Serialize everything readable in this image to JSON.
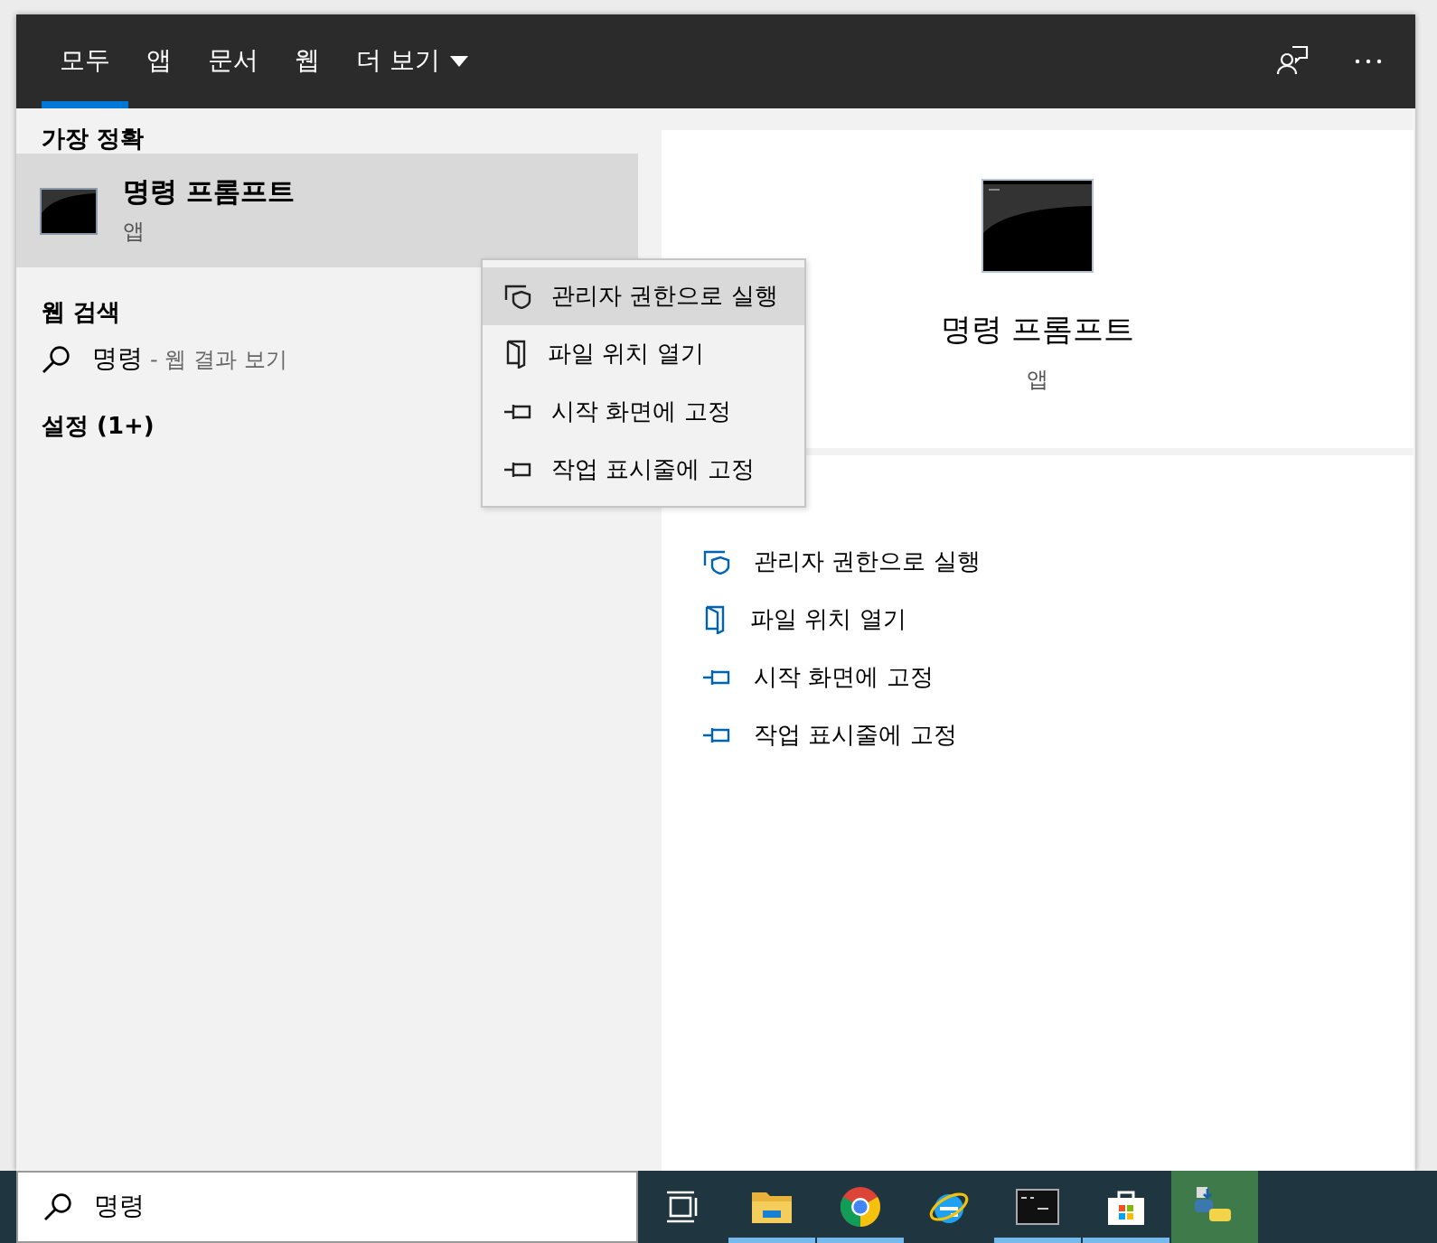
{
  "tabs": [
    {
      "label": "모두",
      "selected": true,
      "dropdown": false
    },
    {
      "label": "앱",
      "selected": false,
      "dropdown": false
    },
    {
      "label": "문서",
      "selected": false,
      "dropdown": false
    },
    {
      "label": "웹",
      "selected": false,
      "dropdown": false
    },
    {
      "label": "더 보기",
      "selected": false,
      "dropdown": true
    }
  ],
  "best_match": {
    "heading": "가장 정확",
    "title": "명령 프롬프트",
    "subtitle": "앱",
    "selected": true
  },
  "web_search": {
    "heading": "웹 검색",
    "query": "명령",
    "hint": "- 웹 결과 보기"
  },
  "settings": {
    "heading": "설정 (1+)"
  },
  "preview": {
    "title": "명령 프롬프트",
    "subtitle": "앱",
    "actions": [
      {
        "kind": "admin",
        "label": "관리자 권한으로 실행"
      },
      {
        "kind": "folder",
        "label": "파일 위치 열기"
      },
      {
        "kind": "pin",
        "label": "시작 화면에 고정"
      },
      {
        "kind": "pin",
        "label": "작업 표시줄에 고정"
      }
    ]
  },
  "context_menu": {
    "items": [
      {
        "kind": "admin",
        "label": "관리자 권한으로 실행",
        "selected": true
      },
      {
        "kind": "folder",
        "label": "파일 위치 열기",
        "selected": false
      },
      {
        "kind": "pin",
        "label": "시작 화면에 고정",
        "selected": false
      },
      {
        "kind": "pin",
        "label": "작업 표시줄에 고정",
        "selected": false
      }
    ]
  },
  "taskbar": {
    "search": {
      "value": "명령"
    },
    "apps": [
      {
        "kind": "taskview",
        "running": false,
        "selected": false
      },
      {
        "kind": "folder",
        "running": true,
        "selected": false
      },
      {
        "kind": "chrome",
        "running": true,
        "selected": false
      },
      {
        "kind": "ie",
        "running": false,
        "selected": false
      },
      {
        "kind": "cmd",
        "running": true,
        "selected": false
      },
      {
        "kind": "store",
        "running": true,
        "selected": false
      },
      {
        "kind": "python",
        "running": false,
        "selected": true
      }
    ]
  }
}
